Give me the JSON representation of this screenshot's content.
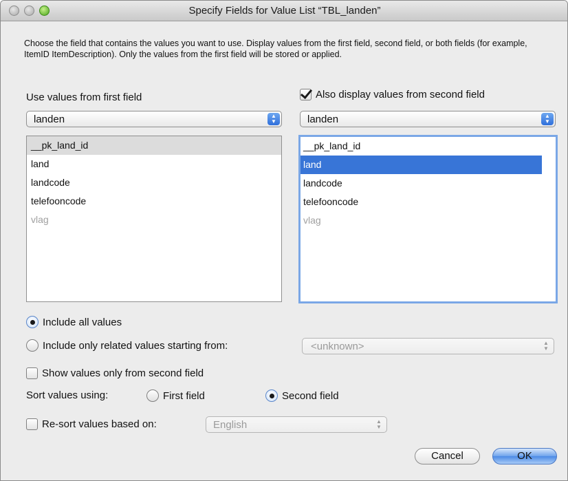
{
  "window": {
    "title": "Specify Fields for Value List “TBL_landen”"
  },
  "description": "Choose the field that contains the values you want to use.  Display values from the first field, second field, or both fields (for example, ItemID ItemDescription). Only the values from the first field will be stored or applied.",
  "first_field": {
    "label": "Use values from first field",
    "table": "landen",
    "items": [
      "__pk_land_id",
      "land",
      "landcode",
      "telefooncode",
      "vlag"
    ],
    "selected": "__pk_land_id"
  },
  "second_field": {
    "checkbox_label": "Also display values from second field",
    "checked": true,
    "table": "landen",
    "items": [
      "__pk_land_id",
      "land",
      "landcode",
      "telefooncode",
      "vlag"
    ],
    "selected": "land"
  },
  "include": {
    "all_label": "Include all values",
    "related_label": "Include only related values starting from:",
    "related_value": "<unknown>",
    "selected": "all"
  },
  "show_second_only": {
    "label": "Show values only from second field",
    "checked": false
  },
  "sort": {
    "label": "Sort values using:",
    "first_label": "First field",
    "second_label": "Second field",
    "selected": "second"
  },
  "resort": {
    "label": "Re-sort values based on:",
    "checked": false,
    "language": "English"
  },
  "buttons": {
    "cancel": "Cancel",
    "ok": "OK"
  },
  "icons": {
    "popup_arrows": "up-down-arrows-icon",
    "check": "checkmark-icon"
  },
  "colors": {
    "selection_blue": "#3875d7",
    "focus_ring": "#7aa7e6",
    "ok_button": "#4c8ae5"
  }
}
